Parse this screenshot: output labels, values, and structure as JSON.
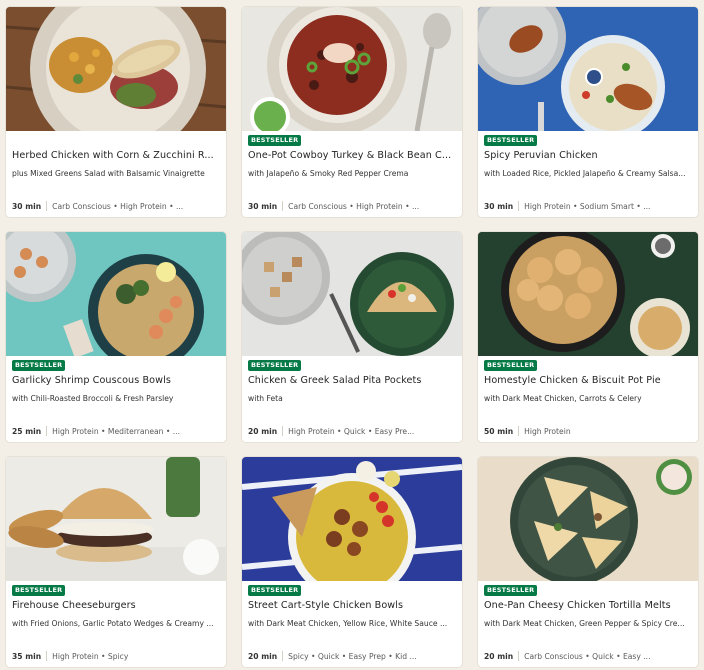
{
  "cards": [
    {
      "badge": "",
      "title": "Herbed Chicken with Corn & Zucchini R...",
      "subtitle": "plus Mixed Greens Salad with Balsamic Vinaigrette",
      "time": "30 min",
      "tags": "Carb Conscious • High Protein • ..."
    },
    {
      "badge": "BESTSELLER",
      "title": "One-Pot Cowboy Turkey & Black Bean C...",
      "subtitle": "with Jalapeño & Smoky Red Pepper Crema",
      "time": "30 min",
      "tags": "Carb Conscious • High Protein • ..."
    },
    {
      "badge": "BESTSELLER",
      "title": "Spicy Peruvian Chicken",
      "subtitle": "with Loaded Rice, Pickled Jalapeño & Creamy Salsa...",
      "time": "30 min",
      "tags": "High Protein • Sodium Smart • ..."
    },
    {
      "badge": "BESTSELLER",
      "title": "Garlicky Shrimp Couscous Bowls",
      "subtitle": "with Chili-Roasted Broccoli & Fresh Parsley",
      "time": "25 min",
      "tags": "High Protein • Mediterranean • ..."
    },
    {
      "badge": "BESTSELLER",
      "title": "Chicken & Greek Salad Pita Pockets",
      "subtitle": "with Feta",
      "time": "20 min",
      "tags": "High Protein • Quick • Easy Pre..."
    },
    {
      "badge": "BESTSELLER",
      "title": "Homestyle Chicken & Biscuit Pot Pie",
      "subtitle": "with Dark Meat Chicken, Carrots & Celery",
      "time": "50 min",
      "tags": "High Protein"
    },
    {
      "badge": "BESTSELLER",
      "title": "Firehouse Cheeseburgers",
      "subtitle": "with Fried Onions, Garlic Potato Wedges & Creamy ...",
      "time": "35 min",
      "tags": "High Protein • Spicy"
    },
    {
      "badge": "BESTSELLER",
      "title": "Street Cart-Style Chicken Bowls",
      "subtitle": "with Dark Meat Chicken, Yellow Rice, White Sauce ...",
      "time": "20 min",
      "tags": "Spicy • Quick • Easy Prep • Kid ..."
    },
    {
      "badge": "BESTSELLER",
      "title": "One-Pan Cheesy Chicken Tortilla Melts",
      "subtitle": "with Dark Meat Chicken, Green Pepper & Spicy Cre...",
      "time": "20 min",
      "tags": "Carb Conscious • Quick • Easy ..."
    }
  ],
  "colors": {
    "badge": "#067a46",
    "page_bg": "#f3efe6"
  }
}
